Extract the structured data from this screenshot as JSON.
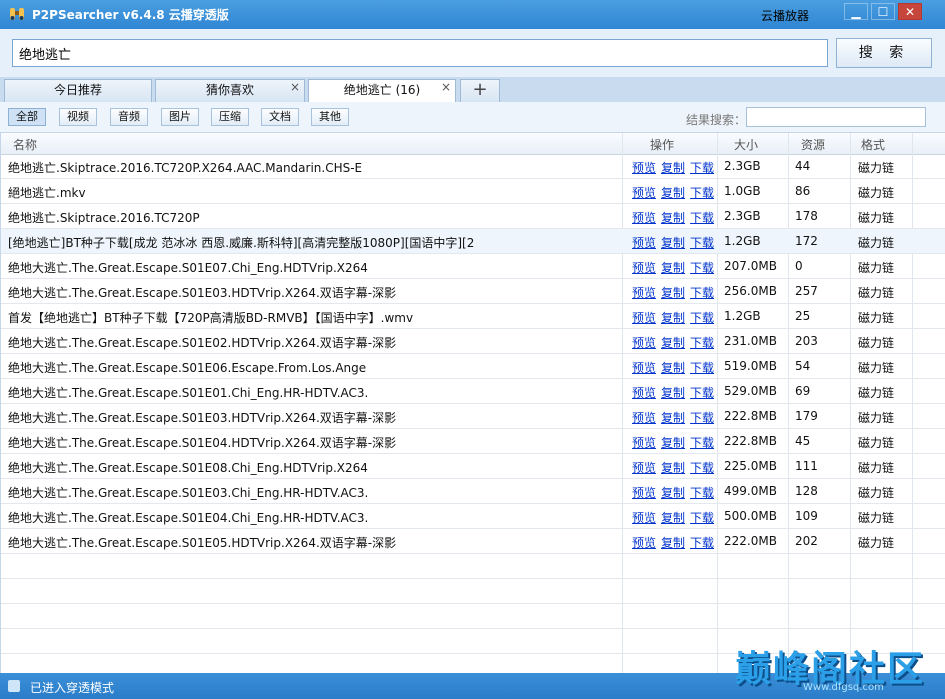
{
  "window": {
    "title": "P2PSearcher v6.4.8 云播穿透版",
    "player_label": "云播放器",
    "min_icon": "minimize-icon",
    "max_icon": "maximize-icon",
    "close_icon": "close-icon"
  },
  "search": {
    "value": "绝地逃亡",
    "button_label": "搜 索"
  },
  "tabs": [
    {
      "label": "今日推荐",
      "closable": false
    },
    {
      "label": "猜你喜欢",
      "closable": true
    },
    {
      "label": "绝地逃亡 (16)",
      "closable": true,
      "active": true
    }
  ],
  "filters": {
    "buttons": [
      "全部",
      "视频",
      "音频",
      "图片",
      "压缩",
      "文档",
      "其他"
    ],
    "active": "全部",
    "result_search_label": "结果搜索："
  },
  "table": {
    "columns": [
      "名称",
      "操作",
      "大小",
      "资源",
      "格式"
    ],
    "op_labels": [
      "预览",
      "复制",
      "下载"
    ],
    "rows": [
      {
        "name": "绝地逃亡.Skiptrace.2016.TC720P.X264.AAC.Mandarin.CHS-E",
        "size": "2.3GB",
        "res": "44",
        "fmt": "磁力链"
      },
      {
        "name": "絕地逃亡.mkv",
        "size": "1.0GB",
        "res": "86",
        "fmt": "磁力链"
      },
      {
        "name": "绝地逃亡.Skiptrace.2016.TC720P",
        "size": "2.3GB",
        "res": "178",
        "fmt": "磁力链"
      },
      {
        "name": "[绝地逃亡]BT种子下载[成龙 范冰冰 西恩.威廉.斯科特][高清完整版1080P][国语中字][2",
        "size": "1.2GB",
        "res": "172",
        "fmt": "磁力链"
      },
      {
        "name": "绝地大逃亡.The.Great.Escape.S01E07.Chi_Eng.HDTVrip.X264",
        "size": "207.0MB",
        "res": "0",
        "fmt": "磁力链"
      },
      {
        "name": "绝地大逃亡.The.Great.Escape.S01E03.HDTVrip.X264.双语字幕-深影",
        "size": "256.0MB",
        "res": "257",
        "fmt": "磁力链"
      },
      {
        "name": "首发【绝地逃亡】BT种子下载【720P高清版BD-RMVB】【国语中字】.wmv",
        "size": "1.2GB",
        "res": "25",
        "fmt": "磁力链"
      },
      {
        "name": "绝地大逃亡.The.Great.Escape.S01E02.HDTVrip.X264.双语字幕-深影",
        "size": "231.0MB",
        "res": "203",
        "fmt": "磁力链"
      },
      {
        "name": "绝地大逃亡.The.Great.Escape.S01E06.Escape.From.Los.Ange",
        "size": "519.0MB",
        "res": "54",
        "fmt": "磁力链"
      },
      {
        "name": "绝地大逃亡.The.Great.Escape.S01E01.Chi_Eng.HR-HDTV.AC3.",
        "size": "529.0MB",
        "res": "69",
        "fmt": "磁力链"
      },
      {
        "name": "绝地大逃亡.The.Great.Escape.S01E03.HDTVrip.X264.双语字幕-深影",
        "size": "222.8MB",
        "res": "179",
        "fmt": "磁力链"
      },
      {
        "name": "绝地大逃亡.The.Great.Escape.S01E04.HDTVrip.X264.双语字幕-深影",
        "size": "222.8MB",
        "res": "45",
        "fmt": "磁力链"
      },
      {
        "name": "绝地大逃亡.The.Great.Escape.S01E08.Chi_Eng.HDTVrip.X264",
        "size": "225.0MB",
        "res": "111",
        "fmt": "磁力链"
      },
      {
        "name": "绝地大逃亡.The.Great.Escape.S01E03.Chi_Eng.HR-HDTV.AC3.",
        "size": "499.0MB",
        "res": "128",
        "fmt": "磁力链"
      },
      {
        "name": "绝地大逃亡.The.Great.Escape.S01E04.Chi_Eng.HR-HDTV.AC3.",
        "size": "500.0MB",
        "res": "109",
        "fmt": "磁力链"
      },
      {
        "name": "绝地大逃亡.The.Great.Escape.S01E05.HDTVrip.X264.双语字幕-深影",
        "size": "222.0MB",
        "res": "202",
        "fmt": "磁力链"
      }
    ],
    "selected_index": 3
  },
  "status": {
    "text": "已进入穿透模式"
  },
  "watermark": {
    "text": "巅峰阁社区",
    "sub": "Www.dfgsq.com"
  }
}
